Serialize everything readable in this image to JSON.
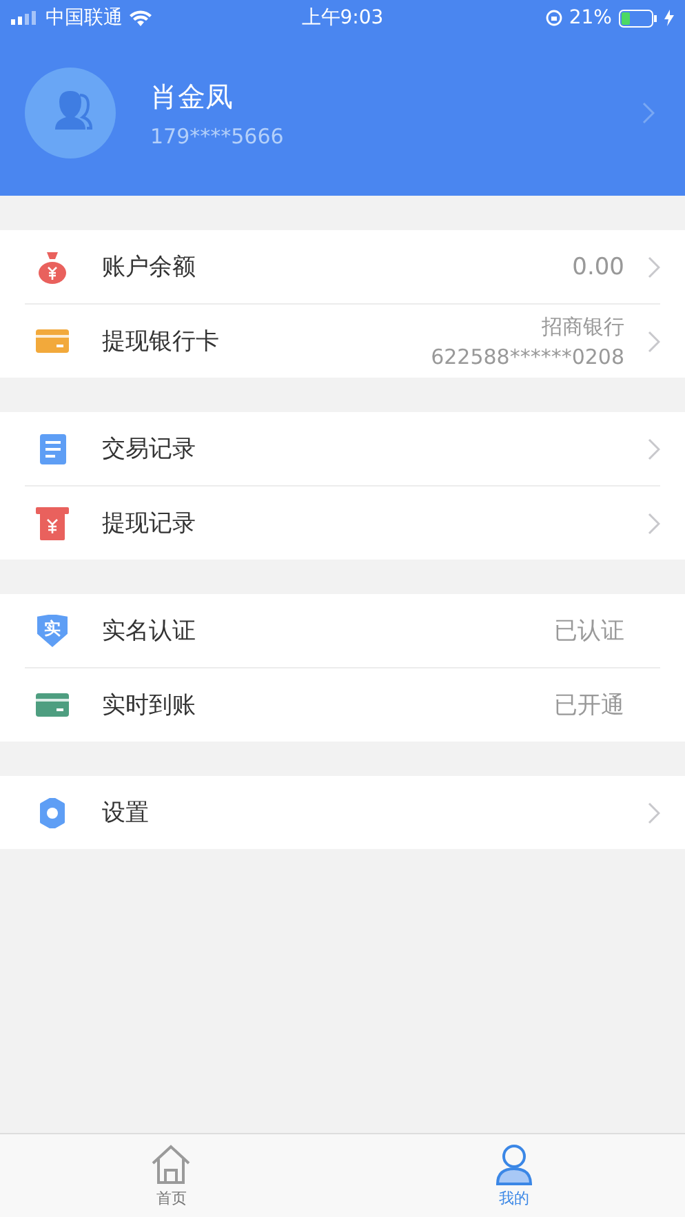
{
  "status_bar": {
    "carrier": "中国联通",
    "time": "上午9:03",
    "battery": "21%"
  },
  "profile": {
    "name": "肖金凤",
    "phone": "179****5666",
    "chevron": true
  },
  "groups": [
    {
      "rows": [
        {
          "label": "账户余额",
          "values": [
            "0.00"
          ],
          "chevron": true
        },
        {
          "label": "提现银行卡",
          "values": [
            "招商银行",
            "622588******0208"
          ],
          "chevron": true
        }
      ]
    },
    {
      "rows": [
        {
          "label": "交易记录",
          "chevron": true
        },
        {
          "label": "提现记录",
          "chevron": true
        }
      ]
    },
    {
      "rows": [
        {
          "label": "实名认证",
          "badge": "实",
          "values": [
            "已认证"
          ],
          "chevron": false
        },
        {
          "label": "实时到账",
          "values": [
            "已开通"
          ],
          "chevron": false
        }
      ]
    },
    {
      "rows": [
        {
          "label": "设置",
          "chevron": true
        }
      ]
    }
  ],
  "tabs": [
    {
      "label": "首页",
      "selected": false
    },
    {
      "label": "我的",
      "selected": true
    }
  ]
}
